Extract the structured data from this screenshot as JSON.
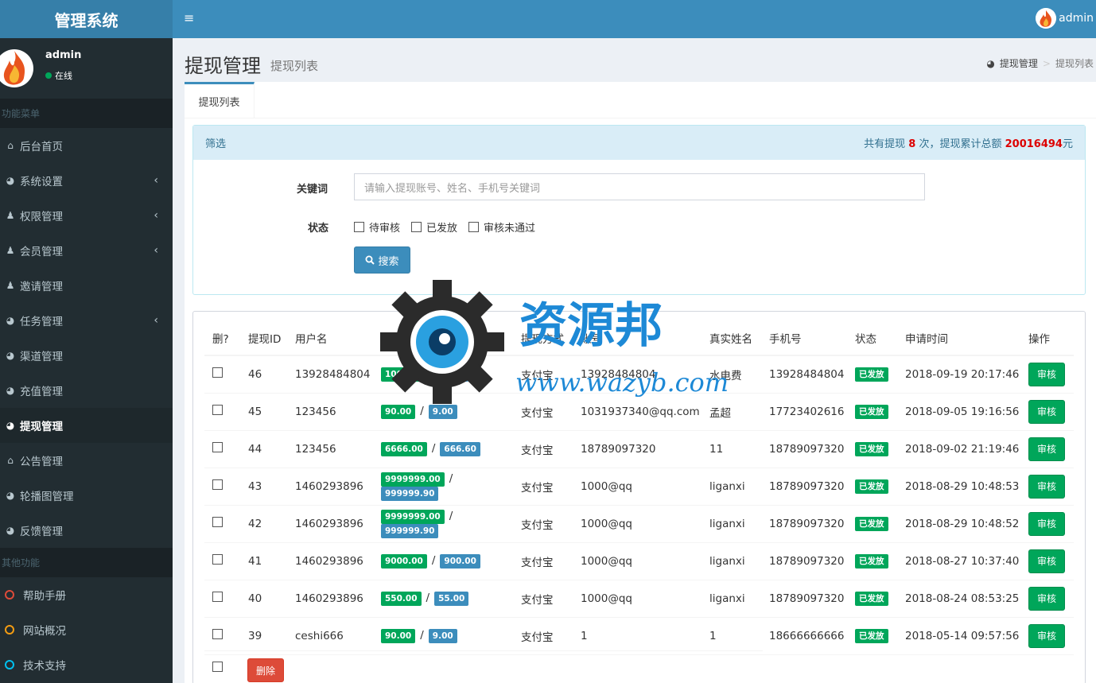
{
  "app": {
    "logo": "管理系统"
  },
  "user": {
    "name": "admin",
    "status": "在线"
  },
  "topbar": {
    "toggle": "≡",
    "username": "admin"
  },
  "sidebar": {
    "header1": "功能菜单",
    "items": [
      {
        "label": "后台首页",
        "icon": "home-icon",
        "glyph": "⌂",
        "chev": ""
      },
      {
        "label": "系统设置",
        "icon": "dashboard-icon",
        "glyph": "◕",
        "chev": "‹"
      },
      {
        "label": "权限管理",
        "icon": "users-icon",
        "glyph": "♟",
        "chev": "‹"
      },
      {
        "label": "会员管理",
        "icon": "users-icon",
        "glyph": "♟",
        "chev": "‹"
      },
      {
        "label": "邀请管理",
        "icon": "users-icon",
        "glyph": "♟",
        "chev": ""
      },
      {
        "label": "任务管理",
        "icon": "dashboard-icon",
        "glyph": "◕",
        "chev": "‹"
      },
      {
        "label": "渠道管理",
        "icon": "dashboard-icon",
        "glyph": "◕",
        "chev": ""
      },
      {
        "label": "充值管理",
        "icon": "dashboard-icon",
        "glyph": "◕",
        "chev": ""
      },
      {
        "label": "提现管理",
        "icon": "dashboard-icon",
        "glyph": "◕",
        "chev": "",
        "active": true
      },
      {
        "label": "公告管理",
        "icon": "home-icon",
        "glyph": "⌂",
        "chev": ""
      },
      {
        "label": "轮播图管理",
        "icon": "dashboard-icon",
        "glyph": "◕",
        "chev": ""
      },
      {
        "label": "反馈管理",
        "icon": "dashboard-icon",
        "glyph": "◕",
        "chev": ""
      }
    ],
    "header2": "其他功能",
    "other": [
      {
        "label": "帮助手册",
        "color": "#dd4b39"
      },
      {
        "label": "网站概况",
        "color": "#f39c12"
      },
      {
        "label": "技术支持",
        "color": "#00c0ef"
      }
    ]
  },
  "page": {
    "title": "提现管理",
    "subtitle": "提现列表",
    "breadcrumb": [
      "提现管理",
      "提现列表"
    ]
  },
  "tabs": [
    "提现列表"
  ],
  "filter": {
    "title": "筛选",
    "summary_prefix": "共有提现 ",
    "count": "8",
    "summary_mid": " 次，提现累计总额 ",
    "total": "20016494",
    "summary_suffix": "元",
    "keyword_label": "关键词",
    "keyword_placeholder": "请输入提现账号、姓名、手机号关键词",
    "status_label": "状态",
    "status_options": [
      "待审核",
      "已发放",
      "审核未通过"
    ],
    "search_button": "搜索"
  },
  "table": {
    "headers": [
      "删?",
      "提现ID",
      "用户名",
      "提现金额/手续费",
      "提现方式",
      "账号",
      "真实姓名",
      "手机号",
      "状态",
      "申请时间",
      "操作"
    ],
    "rows": [
      {
        "id": "46",
        "user": "13928484804",
        "amount": "100.00",
        "fee": "10.00",
        "method": "支付宝",
        "account": "13928484804",
        "name": "水电费",
        "phone": "13928484804",
        "status": "已发放",
        "time": "2018-09-19 20:17:46",
        "action": "审核"
      },
      {
        "id": "45",
        "user": "123456",
        "amount": "90.00",
        "fee": "9.00",
        "method": "支付宝",
        "account": "1031937340@qq.com",
        "name": "孟超",
        "phone": "17723402616",
        "status": "已发放",
        "time": "2018-09-05 19:16:56",
        "action": "审核"
      },
      {
        "id": "44",
        "user": "123456",
        "amount": "6666.00",
        "fee": "666.60",
        "method": "支付宝",
        "account": "18789097320",
        "name": "11",
        "phone": "18789097320",
        "status": "已发放",
        "time": "2018-09-02 21:19:46",
        "action": "审核"
      },
      {
        "id": "43",
        "user": "1460293896",
        "amount": "9999999.00",
        "fee": "999999.90",
        "method": "支付宝",
        "account": "1000@qq",
        "name": "liganxi",
        "phone": "18789097320",
        "status": "已发放",
        "time": "2018-08-29 10:48:53",
        "action": "审核"
      },
      {
        "id": "42",
        "user": "1460293896",
        "amount": "9999999.00",
        "fee": "999999.90",
        "method": "支付宝",
        "account": "1000@qq",
        "name": "liganxi",
        "phone": "18789097320",
        "status": "已发放",
        "time": "2018-08-29 10:48:52",
        "action": "审核"
      },
      {
        "id": "41",
        "user": "1460293896",
        "amount": "9000.00",
        "fee": "900.00",
        "method": "支付宝",
        "account": "1000@qq",
        "name": "liganxi",
        "phone": "18789097320",
        "status": "已发放",
        "time": "2018-08-27 10:37:40",
        "action": "审核"
      },
      {
        "id": "40",
        "user": "1460293896",
        "amount": "550.00",
        "fee": "55.00",
        "method": "支付宝",
        "account": "1000@qq",
        "name": "liganxi",
        "phone": "18789097320",
        "status": "已发放",
        "time": "2018-08-24 08:53:25",
        "action": "审核"
      },
      {
        "id": "39",
        "user": "ceshi666",
        "amount": "90.00",
        "fee": "9.00",
        "method": "支付宝",
        "account": "1",
        "name": "1",
        "phone": "18666666666",
        "status": "已发放",
        "time": "2018-05-14 09:57:56",
        "action": "审核"
      }
    ],
    "delete_button": "删除"
  },
  "watermark": {
    "text_cn": "资源邦",
    "text_url": "www.wazyb.com"
  },
  "colors": {
    "sidebar": "#222d32",
    "topbar": "#3c8dbc",
    "success": "#00a65a",
    "primary": "#3c8dbc",
    "danger": "#dd4b39"
  }
}
